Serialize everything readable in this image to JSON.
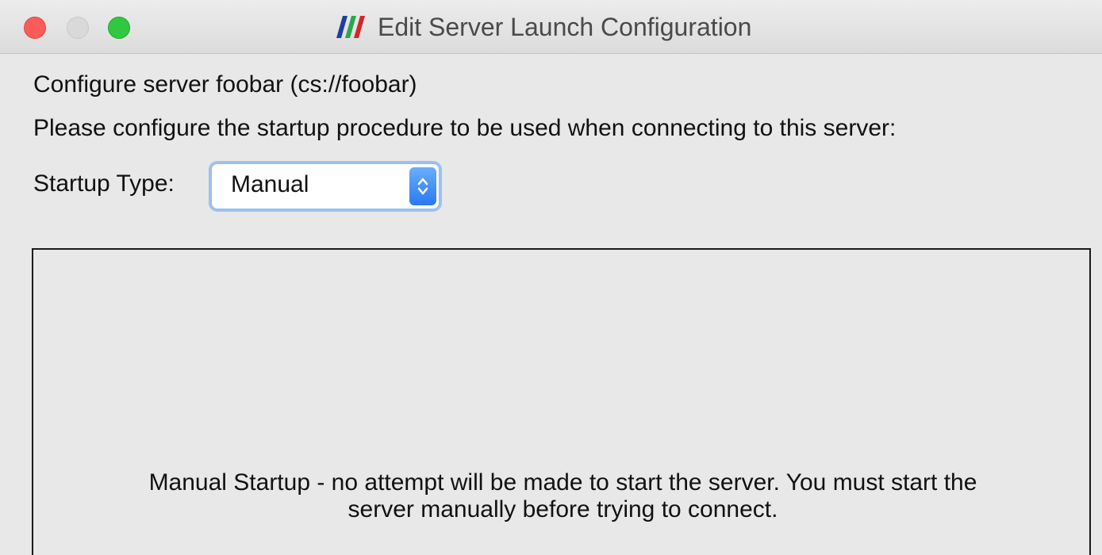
{
  "window": {
    "title": "Edit Server Launch Configuration",
    "app_icon": "paraview-logo-icon",
    "controls": [
      "close-icon",
      "minimize-icon",
      "maximize-icon"
    ]
  },
  "dialog": {
    "configure_line": "Configure server foobar (cs://foobar)",
    "instruction": "Please configure the startup procedure to be used when connecting to this server:",
    "startup_type_label": "Startup Type:",
    "startup_type_value": "Manual",
    "description_line1": "Manual Startup - no attempt will be made to start the server.  You must start the",
    "description_line2": "server manually before trying to connect."
  },
  "colors": {
    "close": "#fc5c57",
    "minimize": "#d9d9d9",
    "maximize": "#2fc840",
    "focus_ring": "#9cc2f2",
    "stepper": "#2a79f0"
  }
}
